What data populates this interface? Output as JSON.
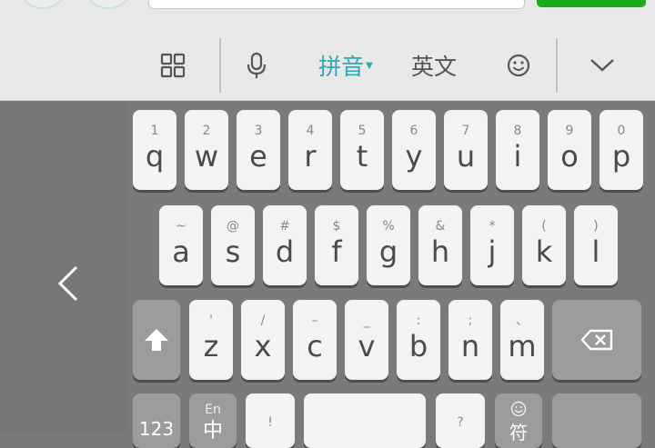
{
  "toolbar": {
    "pinyin_label": "拼音",
    "english_label": "英文"
  },
  "keyboard": {
    "row1": [
      {
        "sec": "1",
        "pri": "q"
      },
      {
        "sec": "2",
        "pri": "w"
      },
      {
        "sec": "3",
        "pri": "e"
      },
      {
        "sec": "4",
        "pri": "r"
      },
      {
        "sec": "5",
        "pri": "t"
      },
      {
        "sec": "6",
        "pri": "y"
      },
      {
        "sec": "7",
        "pri": "u"
      },
      {
        "sec": "8",
        "pri": "i"
      },
      {
        "sec": "9",
        "pri": "o"
      },
      {
        "sec": "0",
        "pri": "p"
      }
    ],
    "row2": [
      {
        "sec": "~",
        "pri": "a"
      },
      {
        "sec": "@",
        "pri": "s"
      },
      {
        "sec": "#",
        "pri": "d"
      },
      {
        "sec": "$",
        "pri": "f"
      },
      {
        "sec": "%",
        "pri": "g"
      },
      {
        "sec": "&",
        "pri": "h"
      },
      {
        "sec": "*",
        "pri": "j"
      },
      {
        "sec": "(",
        "pri": "k"
      },
      {
        "sec": ")",
        "pri": "l"
      }
    ],
    "row3": [
      {
        "sec": "'",
        "pri": "z"
      },
      {
        "sec": "/",
        "pri": "x"
      },
      {
        "sec": "–",
        "pri": "c"
      },
      {
        "sec": "_",
        "pri": "v"
      },
      {
        "sec": ":",
        "pri": "b"
      },
      {
        "sec": ";",
        "pri": "n"
      },
      {
        "sec": "、",
        "pri": "m"
      }
    ],
    "row4": {
      "num_label": "123",
      "lang_top": "En",
      "lang_bottom": "中",
      "punct_top": "!",
      "question_top": "?",
      "emoji_bottom": "符"
    }
  }
}
